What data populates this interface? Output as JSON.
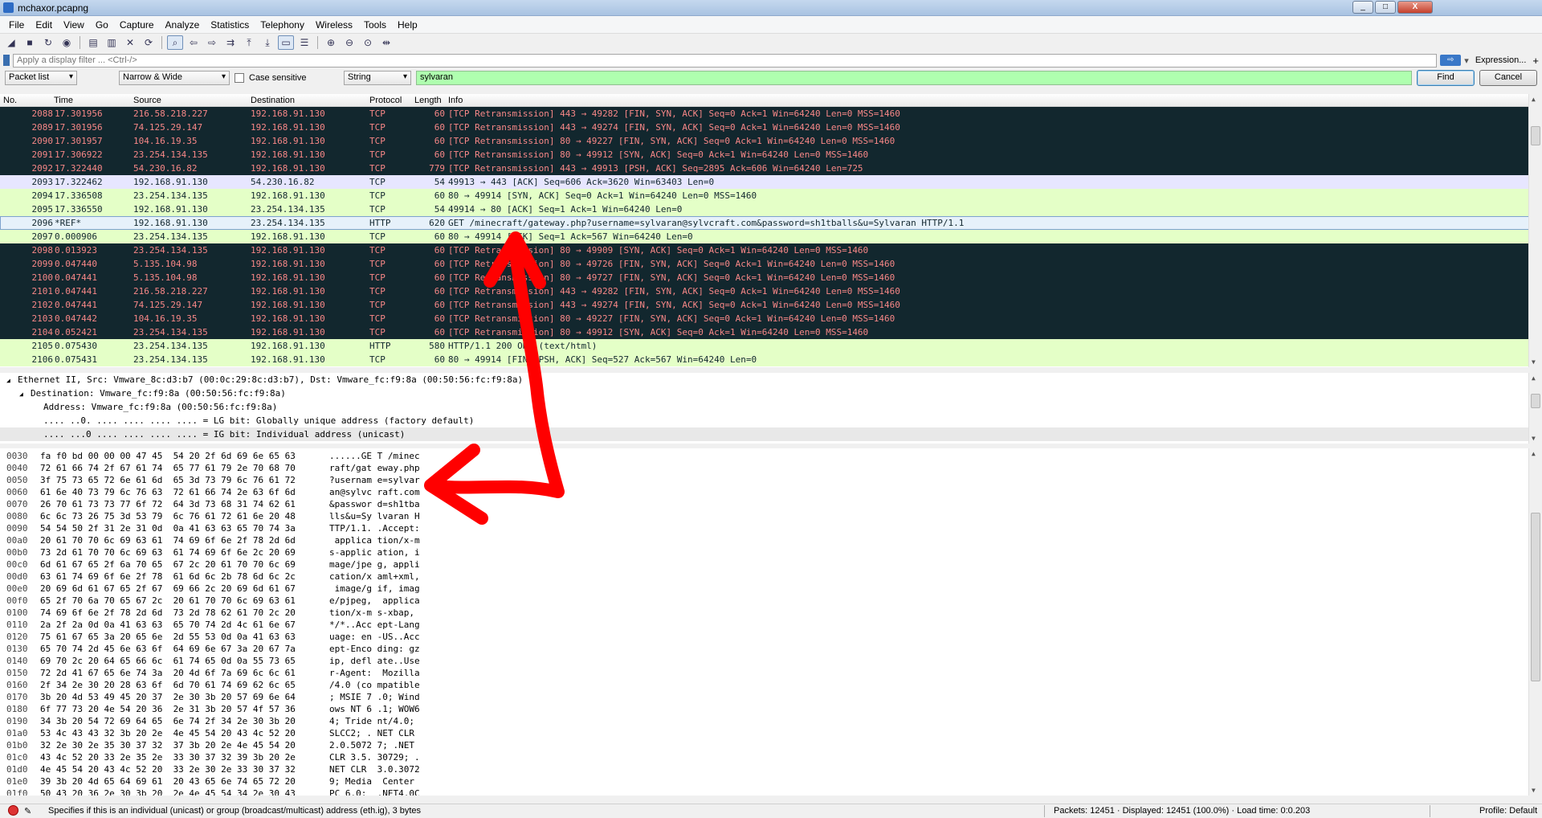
{
  "window": {
    "title": "mchaxor.pcapng",
    "minimize": "_",
    "maximize": "□",
    "close": "X"
  },
  "menu": [
    "File",
    "Edit",
    "View",
    "Go",
    "Capture",
    "Analyze",
    "Statistics",
    "Telephony",
    "Wireless",
    "Tools",
    "Help"
  ],
  "filter": {
    "placeholder": "Apply a display filter ... <Ctrl-/>",
    "expression_label": "Expression...",
    "plus": "+"
  },
  "find": {
    "search_in": "Packet list",
    "char_width": "Narrow & Wide",
    "case_label": "Case sensitive",
    "type": "String",
    "value": "sylvaran",
    "find_label": "Find",
    "cancel_label": "Cancel"
  },
  "columns": [
    "No.",
    "Time",
    "Source",
    "Destination",
    "Protocol",
    "Length",
    "Info"
  ],
  "packets": [
    {
      "no": "2088",
      "time": "17.301956",
      "src": "216.58.218.227",
      "dst": "192.168.91.130",
      "proto": "TCP",
      "len": "60",
      "info": "[TCP Retransmission] 443 → 49282 [FIN, SYN, ACK] Seq=0 Ack=1 Win=64240 Len=0 MSS=1460",
      "style": "dark"
    },
    {
      "no": "2089",
      "time": "17.301956",
      "src": "74.125.29.147",
      "dst": "192.168.91.130",
      "proto": "TCP",
      "len": "60",
      "info": "[TCP Retransmission] 443 → 49274 [FIN, SYN, ACK] Seq=0 Ack=1 Win=64240 Len=0 MSS=1460",
      "style": "dark"
    },
    {
      "no": "2090",
      "time": "17.301957",
      "src": "104.16.19.35",
      "dst": "192.168.91.130",
      "proto": "TCP",
      "len": "60",
      "info": "[TCP Retransmission] 80 → 49227 [FIN, SYN, ACK] Seq=0 Ack=1 Win=64240 Len=0 MSS=1460",
      "style": "dark"
    },
    {
      "no": "2091",
      "time": "17.306922",
      "src": "23.254.134.135",
      "dst": "192.168.91.130",
      "proto": "TCP",
      "len": "60",
      "info": "[TCP Retransmission] 80 → 49912 [SYN, ACK] Seq=0 Ack=1 Win=64240 Len=0 MSS=1460",
      "style": "dark"
    },
    {
      "no": "2092",
      "time": "17.322440",
      "src": "54.230.16.82",
      "dst": "192.168.91.130",
      "proto": "TCP",
      "len": "779",
      "info": "[TCP Retransmission] 443 → 49913 [PSH, ACK] Seq=2895 Ack=606 Win=64240 Len=725",
      "style": "dark"
    },
    {
      "no": "2093",
      "time": "17.322462",
      "src": "192.168.91.130",
      "dst": "54.230.16.82",
      "proto": "TCP",
      "len": "54",
      "info": "49913 → 443 [ACK] Seq=606 Ack=3620 Win=63403 Len=0",
      "style": "ack"
    },
    {
      "no": "2094",
      "time": "17.336508",
      "src": "23.254.134.135",
      "dst": "192.168.91.130",
      "proto": "TCP",
      "len": "60",
      "info": "80 → 49914 [SYN, ACK] Seq=0 Ack=1 Win=64240 Len=0 MSS=1460",
      "style": "green"
    },
    {
      "no": "2095",
      "time": "17.336550",
      "src": "192.168.91.130",
      "dst": "23.254.134.135",
      "proto": "TCP",
      "len": "54",
      "info": "49914 → 80 [ACK] Seq=1 Ack=1 Win=64240 Len=0",
      "style": "green"
    },
    {
      "no": "2096",
      "time": "*REF*",
      "src": "192.168.91.130",
      "dst": "23.254.134.135",
      "proto": "HTTP",
      "len": "620",
      "info": "GET /minecraft/gateway.php?username=sylvaran@sylvcraft.com&password=sh1tballs&u=Sylvaran HTTP/1.1",
      "style": "sel"
    },
    {
      "no": "2097",
      "time": "0.000906",
      "src": "23.254.134.135",
      "dst": "192.168.91.130",
      "proto": "TCP",
      "len": "60",
      "info": "80 → 49914 [ACK] Seq=1 Ack=567 Win=64240 Len=0",
      "style": "green"
    },
    {
      "no": "2098",
      "time": "0.013923",
      "src": "23.254.134.135",
      "dst": "192.168.91.130",
      "proto": "TCP",
      "len": "60",
      "info": "[TCP Retransmission] 80 → 49909 [SYN, ACK] Seq=0 Ack=1 Win=64240 Len=0 MSS=1460",
      "style": "dark"
    },
    {
      "no": "2099",
      "time": "0.047440",
      "src": "5.135.104.98",
      "dst": "192.168.91.130",
      "proto": "TCP",
      "len": "60",
      "info": "[TCP Retransmission] 80 → 49726 [FIN, SYN, ACK] Seq=0 Ack=1 Win=64240 Len=0 MSS=1460",
      "style": "dark"
    },
    {
      "no": "2100",
      "time": "0.047441",
      "src": "5.135.104.98",
      "dst": "192.168.91.130",
      "proto": "TCP",
      "len": "60",
      "info": "[TCP Retransmission] 80 → 49727 [FIN, SYN, ACK] Seq=0 Ack=1 Win=64240 Len=0 MSS=1460",
      "style": "dark"
    },
    {
      "no": "2101",
      "time": "0.047441",
      "src": "216.58.218.227",
      "dst": "192.168.91.130",
      "proto": "TCP",
      "len": "60",
      "info": "[TCP Retransmission] 443 → 49282 [FIN, SYN, ACK] Seq=0 Ack=1 Win=64240 Len=0 MSS=1460",
      "style": "dark"
    },
    {
      "no": "2102",
      "time": "0.047441",
      "src": "74.125.29.147",
      "dst": "192.168.91.130",
      "proto": "TCP",
      "len": "60",
      "info": "[TCP Retransmission] 443 → 49274 [FIN, SYN, ACK] Seq=0 Ack=1 Win=64240 Len=0 MSS=1460",
      "style": "dark"
    },
    {
      "no": "2103",
      "time": "0.047442",
      "src": "104.16.19.35",
      "dst": "192.168.91.130",
      "proto": "TCP",
      "len": "60",
      "info": "[TCP Retransmission] 80 → 49227 [FIN, SYN, ACK] Seq=0 Ack=1 Win=64240 Len=0 MSS=1460",
      "style": "dark"
    },
    {
      "no": "2104",
      "time": "0.052421",
      "src": "23.254.134.135",
      "dst": "192.168.91.130",
      "proto": "TCP",
      "len": "60",
      "info": "[TCP Retransmission] 80 → 49912 [SYN, ACK] Seq=0 Ack=1 Win=64240 Len=0 MSS=1460",
      "style": "dark"
    },
    {
      "no": "2105",
      "time": "0.075430",
      "src": "23.254.134.135",
      "dst": "192.168.91.130",
      "proto": "HTTP",
      "len": "580",
      "info": "HTTP/1.1 200 OK  (text/html)",
      "style": "green"
    },
    {
      "no": "2106",
      "time": "0.075431",
      "src": "23.254.134.135",
      "dst": "192.168.91.130",
      "proto": "TCP",
      "len": "60",
      "info": "80 → 49914 [FIN, PSH, ACK] Seq=527 Ack=567 Win=64240 Len=0",
      "style": "green"
    }
  ],
  "details": [
    {
      "text": "Ethernet II, Src: Vmware_8c:d3:b7 (00:0c:29:8c:d3:b7), Dst: Vmware_fc:f9:8a (00:50:56:fc:f9:8a)",
      "indent": 0,
      "toggle": "◢"
    },
    {
      "text": "Destination: Vmware_fc:f9:8a (00:50:56:fc:f9:8a)",
      "indent": 1,
      "toggle": "◢"
    },
    {
      "text": "Address: Vmware_fc:f9:8a (00:50:56:fc:f9:8a)",
      "indent": 2,
      "toggle": ""
    },
    {
      "text": ".... ..0. .... .... .... .... = LG bit: Globally unique address (factory default)",
      "indent": 2,
      "toggle": ""
    },
    {
      "text": ".... ...0 .... .... .... .... = IG bit: Individual address (unicast)",
      "indent": 2,
      "toggle": "",
      "hl": true
    }
  ],
  "bytes": [
    {
      "off": "0030",
      "hex": "fa f0 bd 00 00 00 47 45  54 20 2f 6d 69 6e 65 63",
      "asc": "......GE T /minec"
    },
    {
      "off": "0040",
      "hex": "72 61 66 74 2f 67 61 74  65 77 61 79 2e 70 68 70",
      "asc": "raft/gat eway.php"
    },
    {
      "off": "0050",
      "hex": "3f 75 73 65 72 6e 61 6d  65 3d 73 79 6c 76 61 72",
      "asc": "?usernam e=sylvar"
    },
    {
      "off": "0060",
      "hex": "61 6e 40 73 79 6c 76 63  72 61 66 74 2e 63 6f 6d",
      "asc": "an@sylvc raft.com"
    },
    {
      "off": "0070",
      "hex": "26 70 61 73 73 77 6f 72  64 3d 73 68 31 74 62 61",
      "asc": "&passwor d=sh1tba"
    },
    {
      "off": "0080",
      "hex": "6c 6c 73 26 75 3d 53 79  6c 76 61 72 61 6e 20 48",
      "asc": "lls&u=Sy lvaran H"
    },
    {
      "off": "0090",
      "hex": "54 54 50 2f 31 2e 31 0d  0a 41 63 63 65 70 74 3a",
      "asc": "TTP/1.1. .Accept:"
    },
    {
      "off": "00a0",
      "hex": "20 61 70 70 6c 69 63 61  74 69 6f 6e 2f 78 2d 6d",
      "asc": " applica tion/x-m"
    },
    {
      "off": "00b0",
      "hex": "73 2d 61 70 70 6c 69 63  61 74 69 6f 6e 2c 20 69",
      "asc": "s-applic ation, i"
    },
    {
      "off": "00c0",
      "hex": "6d 61 67 65 2f 6a 70 65  67 2c 20 61 70 70 6c 69",
      "asc": "mage/jpe g, appli"
    },
    {
      "off": "00d0",
      "hex": "63 61 74 69 6f 6e 2f 78  61 6d 6c 2b 78 6d 6c 2c",
      "asc": "cation/x aml+xml,"
    },
    {
      "off": "00e0",
      "hex": "20 69 6d 61 67 65 2f 67  69 66 2c 20 69 6d 61 67",
      "asc": " image/g if, imag"
    },
    {
      "off": "00f0",
      "hex": "65 2f 70 6a 70 65 67 2c  20 61 70 70 6c 69 63 61",
      "asc": "e/pjpeg,  applica"
    },
    {
      "off": "0100",
      "hex": "74 69 6f 6e 2f 78 2d 6d  73 2d 78 62 61 70 2c 20",
      "asc": "tion/x-m s-xbap, "
    },
    {
      "off": "0110",
      "hex": "2a 2f 2a 0d 0a 41 63 63  65 70 74 2d 4c 61 6e 67",
      "asc": "*/*..Acc ept-Lang"
    },
    {
      "off": "0120",
      "hex": "75 61 67 65 3a 20 65 6e  2d 55 53 0d 0a 41 63 63",
      "asc": "uage: en -US..Acc"
    },
    {
      "off": "0130",
      "hex": "65 70 74 2d 45 6e 63 6f  64 69 6e 67 3a 20 67 7a",
      "asc": "ept-Enco ding: gz"
    },
    {
      "off": "0140",
      "hex": "69 70 2c 20 64 65 66 6c  61 74 65 0d 0a 55 73 65",
      "asc": "ip, defl ate..Use"
    },
    {
      "off": "0150",
      "hex": "72 2d 41 67 65 6e 74 3a  20 4d 6f 7a 69 6c 6c 61",
      "asc": "r-Agent:  Mozilla"
    },
    {
      "off": "0160",
      "hex": "2f 34 2e 30 20 28 63 6f  6d 70 61 74 69 62 6c 65",
      "asc": "/4.0 (co mpatible"
    },
    {
      "off": "0170",
      "hex": "3b 20 4d 53 49 45 20 37  2e 30 3b 20 57 69 6e 64",
      "asc": "; MSIE 7 .0; Wind"
    },
    {
      "off": "0180",
      "hex": "6f 77 73 20 4e 54 20 36  2e 31 3b 20 57 4f 57 36",
      "asc": "ows NT 6 .1; WOW6"
    },
    {
      "off": "0190",
      "hex": "34 3b 20 54 72 69 64 65  6e 74 2f 34 2e 30 3b 20",
      "asc": "4; Tride nt/4.0; "
    },
    {
      "off": "01a0",
      "hex": "53 4c 43 43 32 3b 20 2e  4e 45 54 20 43 4c 52 20",
      "asc": "SLCC2; . NET CLR "
    },
    {
      "off": "01b0",
      "hex": "32 2e 30 2e 35 30 37 32  37 3b 20 2e 4e 45 54 20",
      "asc": "2.0.5072 7; .NET "
    },
    {
      "off": "01c0",
      "hex": "43 4c 52 20 33 2e 35 2e  33 30 37 32 39 3b 20 2e",
      "asc": "CLR 3.5. 30729; ."
    },
    {
      "off": "01d0",
      "hex": "4e 45 54 20 43 4c 52 20  33 2e 30 2e 33 30 37 32",
      "asc": "NET CLR  3.0.3072"
    },
    {
      "off": "01e0",
      "hex": "39 3b 20 4d 65 64 69 61  20 43 65 6e 74 65 72 20",
      "asc": "9; Media  Center "
    },
    {
      "off": "01f0",
      "hex": "50 43 20 36 2e 30 3b 20  2e 4e 45 54 34 2e 30 43",
      "asc": "PC 6.0;  .NET4.0C"
    }
  ],
  "status": {
    "field_info": "Specifies if this is an individual (unicast) or group (broadcast/multicast) address (eth.ig), 3 bytes",
    "packets": "Packets: 12451 · Displayed: 12451 (100.0%) · Load time: 0:0.203",
    "profile": "Profile: Default"
  },
  "colors": {
    "dark_row_bg": "#12272e",
    "dark_row_fg": "#f78787",
    "http_green": "#e4ffc7",
    "find_bg": "#afffaf",
    "annotation": "#ff0000"
  }
}
